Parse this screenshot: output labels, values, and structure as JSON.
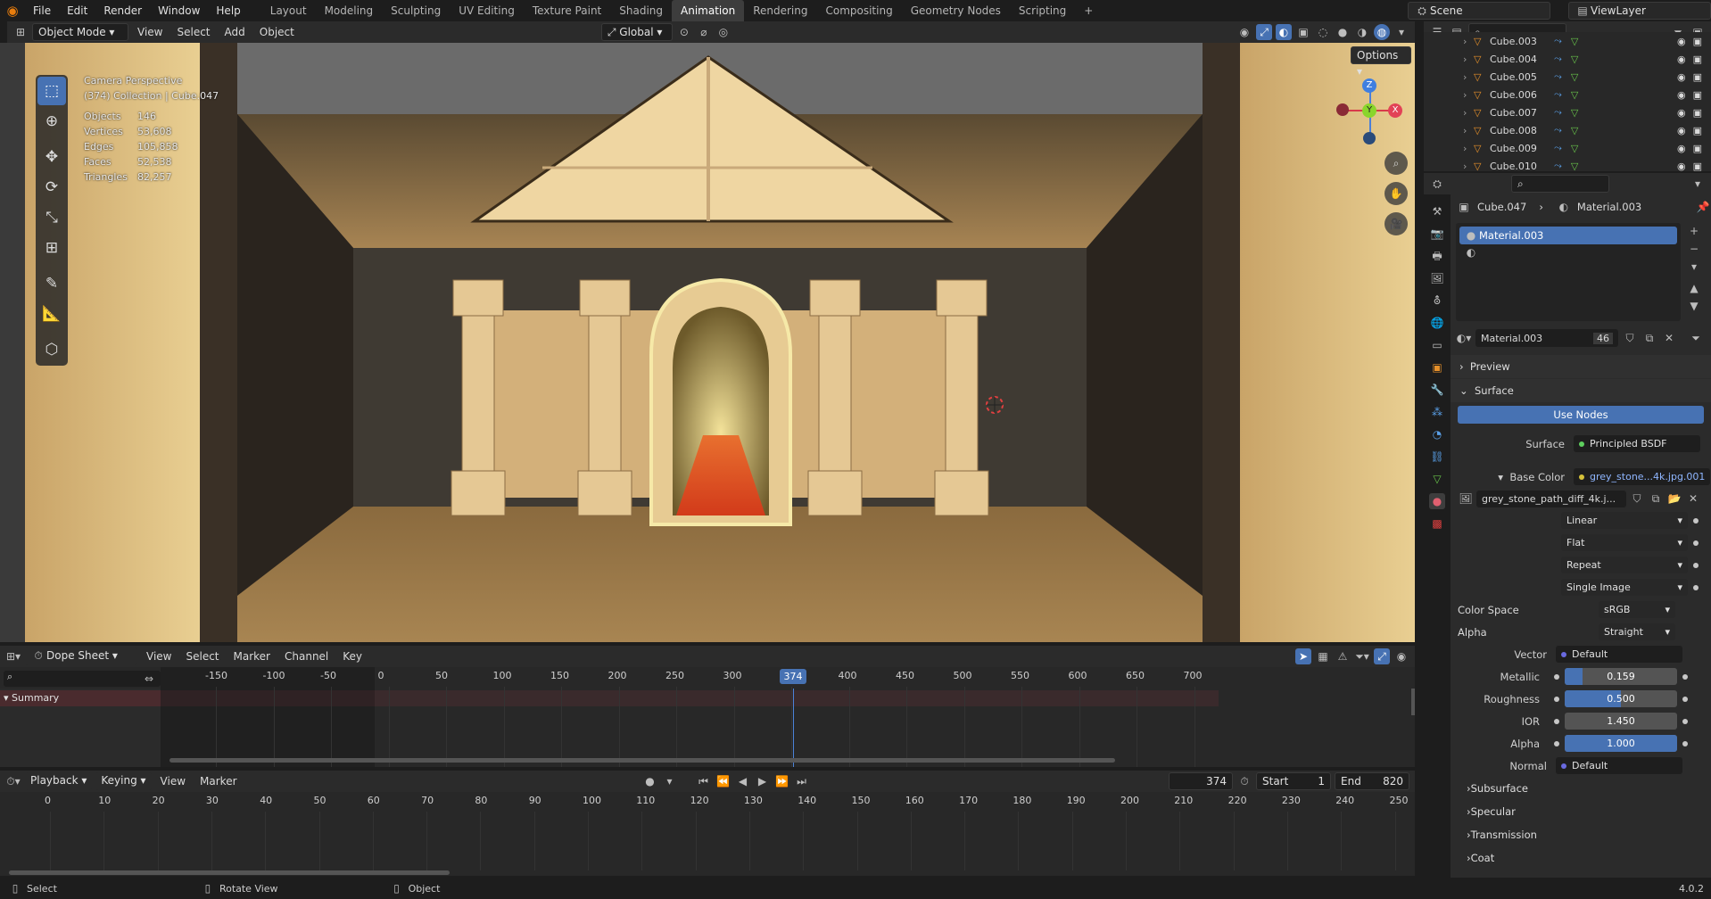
{
  "app": {
    "menus": [
      "File",
      "Edit",
      "Render",
      "Window",
      "Help"
    ],
    "workspaces": [
      "Layout",
      "Modeling",
      "Sculpting",
      "UV Editing",
      "Texture Paint",
      "Shading",
      "Animation",
      "Rendering",
      "Compositing",
      "Geometry Nodes",
      "Scripting"
    ],
    "active_workspace": "Animation",
    "scene": "Scene",
    "view_layer": "ViewLayer"
  },
  "viewport": {
    "mode": "Object Mode",
    "menus": [
      "View",
      "Select",
      "Add",
      "Object"
    ],
    "transform": "Global",
    "options": "Options",
    "overlay": {
      "title": "Camera Perspective",
      "collection": "(374) Collection | Cube.047",
      "stats": [
        {
          "label": "Objects",
          "value": "146"
        },
        {
          "label": "Vertices",
          "value": "53,608"
        },
        {
          "label": "Edges",
          "value": "105,858"
        },
        {
          "label": "Faces",
          "value": "52,538"
        },
        {
          "label": "Triangles",
          "value": "82,257"
        }
      ]
    },
    "gizmo": {
      "x": "X",
      "y": "Y",
      "z": "Z"
    }
  },
  "outliner": {
    "items": [
      "Cube.003",
      "Cube.004",
      "Cube.005",
      "Cube.006",
      "Cube.007",
      "Cube.008",
      "Cube.009",
      "Cube.010"
    ]
  },
  "properties": {
    "breadcrumb_object": "Cube.047",
    "breadcrumb_material": "Material.003",
    "slot": "Material.003",
    "material_name": "Material.003",
    "users": "46",
    "preview": "Preview",
    "surface_section": "Surface",
    "use_nodes": "Use Nodes",
    "rows": [
      {
        "label": "Surface",
        "value": "Principled BSDF"
      },
      {
        "label": "Base Color",
        "value": "grey_stone...4k.jpg.001"
      }
    ],
    "image": "grey_stone_path_diff_4k.j...",
    "image_options": [
      "Linear",
      "Flat",
      "Repeat",
      "Single Image"
    ],
    "color_space": {
      "label": "Color Space",
      "value": "sRGB"
    },
    "alpha": {
      "label": "Alpha",
      "value": "Straight"
    },
    "vector": {
      "label": "Vector",
      "value": "Default"
    },
    "metallic": {
      "label": "Metallic",
      "value": "0.159",
      "fraction": 0.159
    },
    "roughness": {
      "label": "Roughness",
      "value": "0.500",
      "fraction": 0.5
    },
    "ior": {
      "label": "IOR",
      "value": "1.450",
      "fraction": 0.0
    },
    "alpha_val": {
      "label": "Alpha",
      "value": "1.000",
      "fraction": 1.0
    },
    "normal": {
      "label": "Normal",
      "value": "Default"
    },
    "subsections": [
      "Subsurface",
      "Specular",
      "Transmission",
      "Coat"
    ]
  },
  "dopesheet": {
    "editor": "Dope Sheet",
    "menus": [
      "View",
      "Select",
      "Marker",
      "Channel",
      "Key"
    ],
    "summary": "Summary",
    "ticks": [
      "-150",
      "-100",
      "-50",
      "0",
      "50",
      "100",
      "150",
      "200",
      "250",
      "300",
      "350",
      "400",
      "450",
      "500",
      "550",
      "600",
      "650",
      "700"
    ],
    "current_frame": "374"
  },
  "timeline": {
    "menus": [
      "Playback",
      "Keying",
      "View",
      "Marker"
    ],
    "frame": "374",
    "start_label": "Start",
    "start": "1",
    "end_label": "End",
    "end": "820",
    "ticks": [
      "0",
      "10",
      "20",
      "30",
      "40",
      "50",
      "60",
      "70",
      "80",
      "90",
      "100",
      "110",
      "120",
      "130",
      "140",
      "150",
      "160",
      "170",
      "180",
      "190",
      "200",
      "210",
      "220",
      "230",
      "240",
      "250"
    ]
  },
  "status": {
    "select": "Select",
    "rotate": "Rotate View",
    "object": "Object",
    "version": "4.0.2"
  }
}
